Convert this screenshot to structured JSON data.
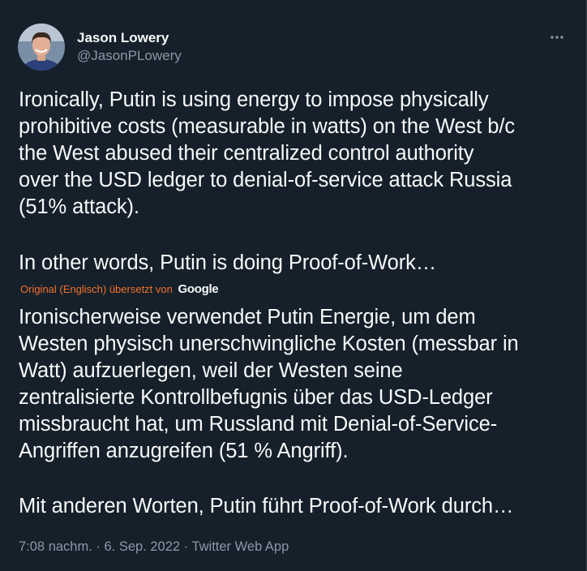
{
  "author": {
    "display_name": "Jason Lowery",
    "handle": "@JasonPLowery",
    "avatar_icon": "profile-avatar"
  },
  "more_icon": "more-options-icon",
  "tweet": {
    "original_text": "Ironically, Putin is using energy to impose physically\nprohibitive costs (measurable in watts) on the West b/c\nthe West abused their centralized control authority\nover the USD ledger to denial-of-service attack Russia\n(51% attack).",
    "original_text_2": "In other words, Putin is doing Proof-of-Work…",
    "translation_notice": "Original (Englisch) übersetzt von",
    "translation_provider": "Google",
    "translated_text": "Ironischerweise verwendet Putin Energie, um dem\nWesten physisch unerschwingliche Kosten (messbar in\nWatt) aufzuerlegen, weil der Westen seine\nzentralisierte Kontrollbefugnis über das USD-Ledger\nmissbraucht hat, um Russland mit Denial-of-Service-\nAngriffen anzugreifen (51 % Angriff).",
    "translated_text_2": "Mit anderen Worten, Putin führt Proof-of-Work durch…"
  },
  "meta": {
    "time": "7:08 nachm.",
    "separator": " · ",
    "date": "6. Sep. 2022",
    "source": "Twitter Web App"
  },
  "colors": {
    "background": "#15202b",
    "text": "#f7f9f9",
    "secondary": "#8b98a5",
    "translation_accent": "#f4712a"
  }
}
